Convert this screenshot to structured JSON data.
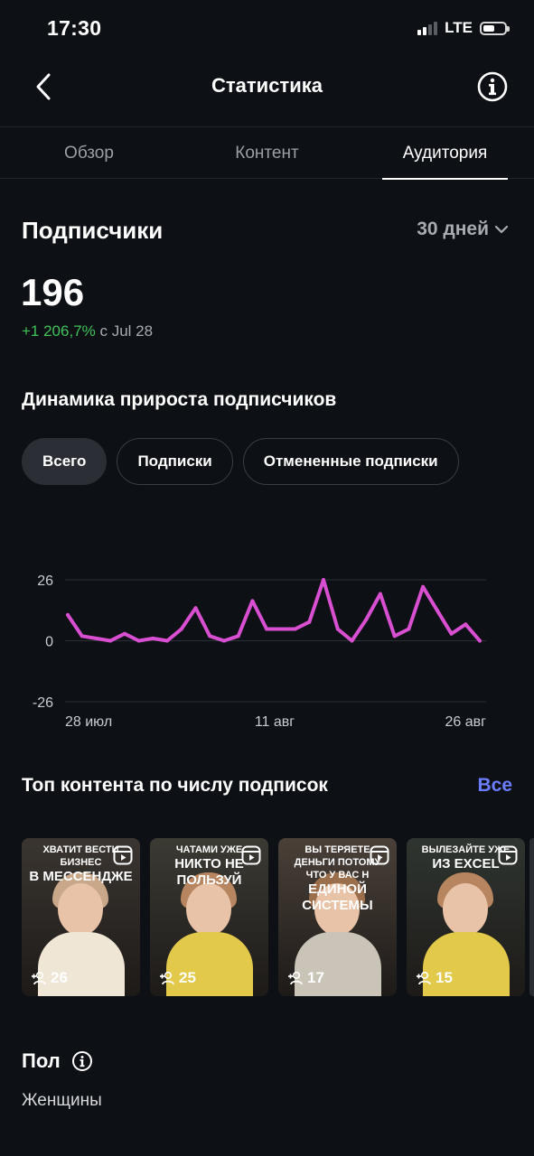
{
  "status": {
    "time": "17:30",
    "network": "LTE"
  },
  "header": {
    "title": "Статистика"
  },
  "tabs": [
    {
      "label": "Обзор",
      "active": false
    },
    {
      "label": "Контент",
      "active": false
    },
    {
      "label": "Аудитория",
      "active": true
    }
  ],
  "subscribers": {
    "title": "Подписчики",
    "period": "30 дней",
    "count": "196",
    "growth_value": "+1 206,7%",
    "growth_since": "с Jul 28"
  },
  "dynamics": {
    "title": "Динамика прироста подписчиков",
    "chips": [
      {
        "label": "Всего",
        "active": true
      },
      {
        "label": "Подписки",
        "active": false
      },
      {
        "label": "Отмененные подписки",
        "active": false
      }
    ]
  },
  "chart_data": {
    "type": "line",
    "x_tick_labels": [
      "28 июл",
      "11 авг",
      "26 авг"
    ],
    "y_tick_labels": [
      "26",
      "0",
      "-26"
    ],
    "ylim": [
      -26,
      26
    ],
    "grid": true,
    "series": [
      {
        "color": "#d94fd1",
        "values": [
          11,
          2,
          1,
          0,
          3,
          0,
          1,
          0,
          5,
          14,
          2,
          0,
          2,
          17,
          5,
          5,
          5,
          8,
          26,
          5,
          0,
          9,
          20,
          2,
          5,
          23,
          13,
          3,
          7,
          0
        ]
      }
    ]
  },
  "top_content": {
    "title": "Топ контента по числу подписок",
    "see_all": "Все",
    "items": [
      {
        "caption_small": "Хватит вести бизнес",
        "caption_big": "в мессендже",
        "count": "26",
        "bg": "#3a3530",
        "hair": "#c9a88a",
        "body": "#efe6d6"
      },
      {
        "caption_small": "чатами уже",
        "caption_big": "никто не пользуй",
        "count": "25",
        "bg": "#3b3a33",
        "hair": "#b78560",
        "body": "#e2c94a"
      },
      {
        "caption_small": "Вы теряете деньги потому что у вас н",
        "caption_big": "единой системы",
        "count": "17",
        "bg": "#4a4038",
        "hair": "#9c6f4c",
        "body": "#c9c3b8"
      },
      {
        "caption_small": "Вылезайте уже",
        "caption_big": "из Excel",
        "count": "15",
        "bg": "#2f3530",
        "hair": "#b78560",
        "body": "#e2c94a"
      }
    ]
  },
  "gender": {
    "title": "Пол",
    "value": "Женщины"
  },
  "colors": {
    "accent": "#6c7cff",
    "positive": "#3fc35a",
    "chart_line": "#d94fd1"
  }
}
